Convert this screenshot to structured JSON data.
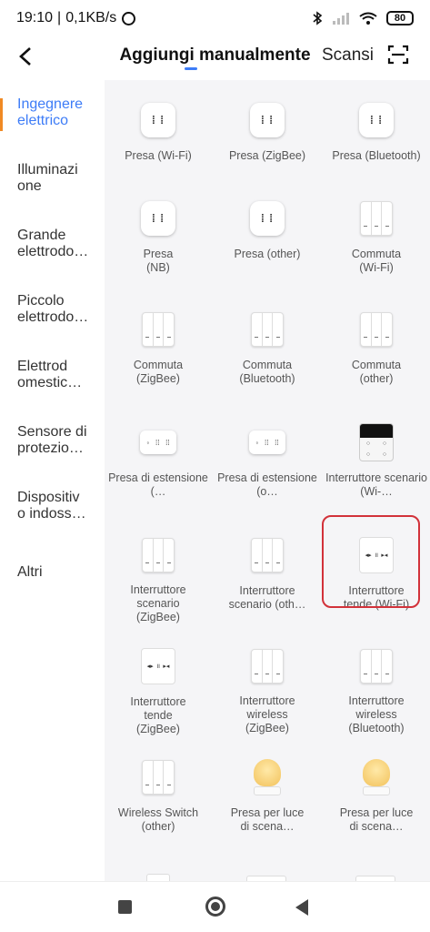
{
  "status": {
    "time": "19:10",
    "speed": "0,1KB/s",
    "battery": "80"
  },
  "header": {
    "title": "Aggiungi manualmente",
    "scan_label": "Scansi"
  },
  "sidebar": {
    "items": [
      {
        "label": "Ingegnere elettrico",
        "active": true
      },
      {
        "label": "Illuminazi one"
      },
      {
        "label": "Grande elettrodo…"
      },
      {
        "label": "Piccolo elettrodo…"
      },
      {
        "label": "Elettrod omestic…"
      },
      {
        "label": "Sensore di protezio…"
      },
      {
        "label": "Dispositiv o indoss…"
      },
      {
        "label": "Altri"
      }
    ]
  },
  "devices": [
    {
      "label": "Presa (Wi-Fi)",
      "icon": "socket-icon"
    },
    {
      "label": "Presa (ZigBee)",
      "icon": "socket-icon"
    },
    {
      "label": "Presa (Bluetooth)",
      "icon": "socket-icon"
    },
    {
      "label": "Presa (NB)",
      "icon": "socket-icon"
    },
    {
      "label": "Presa (other)",
      "icon": "socket-icon"
    },
    {
      "label": "Commuta (Wi-Fi)",
      "icon": "switch-icon"
    },
    {
      "label": "Commuta (ZigBee)",
      "icon": "switch-icon"
    },
    {
      "label": "Commuta (Bluetooth)",
      "icon": "switch-icon"
    },
    {
      "label": "Commuta (other)",
      "icon": "switch-icon"
    },
    {
      "label": "Presa di estensione (…",
      "icon": "power-strip-icon"
    },
    {
      "label": "Presa di estensione (o…",
      "icon": "power-strip-icon"
    },
    {
      "label": "Interruttore scenario (Wi-…",
      "icon": "scene-switch-icon"
    },
    {
      "label": "Interruttore scenario (ZigBee)",
      "icon": "switch-icon"
    },
    {
      "label": "Interruttore scenario (oth…",
      "icon": "switch-icon"
    },
    {
      "label": "Interruttore tende (Wi-Fi)",
      "icon": "curtain-switch-icon",
      "selected": true
    },
    {
      "label": "Interruttore tende (ZigBee)",
      "icon": "curtain-switch-icon"
    },
    {
      "label": "Interruttore wireless (ZigBee)",
      "icon": "switch-icon"
    },
    {
      "label": "Interruttore wireless (Bluetooth)",
      "icon": "switch-icon"
    },
    {
      "label": "Wireless Switch (other)",
      "icon": "switch-icon"
    },
    {
      "label": "Presa per luce di scena…",
      "icon": "lamp-icon"
    },
    {
      "label": "Presa per luce di scena…",
      "icon": "lamp-icon"
    }
  ],
  "colors": {
    "accent": "#3d7cf7",
    "selection": "#d2323a",
    "indicator": "#f08a24"
  }
}
